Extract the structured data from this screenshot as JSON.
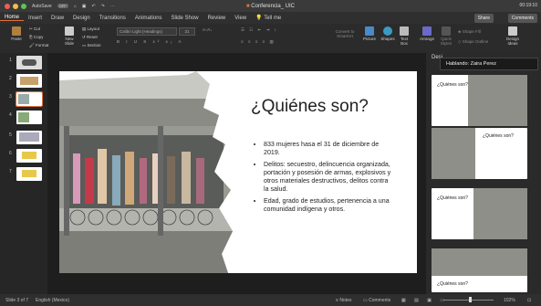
{
  "titlebar": {
    "autosave_label": "AutoSave",
    "autosave_state": "OFF",
    "doc_title": "Conferencia_ UIC",
    "clock": "00:19:10"
  },
  "tabs": [
    "Home",
    "Insert",
    "Draw",
    "Design",
    "Transitions",
    "Animations",
    "Slide Show",
    "Review",
    "View"
  ],
  "tell_me": "Tell me",
  "share_label": "Share",
  "comments_label": "Comments",
  "ribbon": {
    "paste": "Paste",
    "cut": "Cut",
    "copy": "Copy",
    "format": "Format",
    "new_slide": "New\nSlide",
    "layout": "Layout",
    "reset": "Reset",
    "section": "Section",
    "font_name": "Calibri Light (Headings)",
    "font_size": "31",
    "convert": "Convert to\nSmartArt",
    "picture": "Picture",
    "shapes": "Shapes",
    "textbox": "Text\nBox",
    "arrange": "Arrange",
    "quick_styles": "Quick\nStyles",
    "shape_fill": "Shape Fill",
    "shape_outline": "Shape Outline",
    "design_ideas": "Design\nIdeas"
  },
  "slides_count": [
    1,
    2,
    3,
    4,
    5,
    6,
    7
  ],
  "slide": {
    "title": "¿Quiénes son?",
    "bullets": [
      "833 mujeres hasa el 31 de diciembre de 2019.",
      "Delitos: secuestro, delincuencia organizada, portación y posesión de armas, explosivos y otros materiales destructivos, delitos contra la salud.",
      "Edad, grado de estudios, pertenencia a una comunidad indígena y otros."
    ]
  },
  "right_panel": {
    "title": "Desi",
    "speaker": "Hablando: Zaira Perez"
  },
  "statusbar": {
    "slide_info": "Slide 3 of 7",
    "language": "English (Mexico)",
    "notes": "Notes",
    "comments": "Comments",
    "zoom": "102%"
  }
}
